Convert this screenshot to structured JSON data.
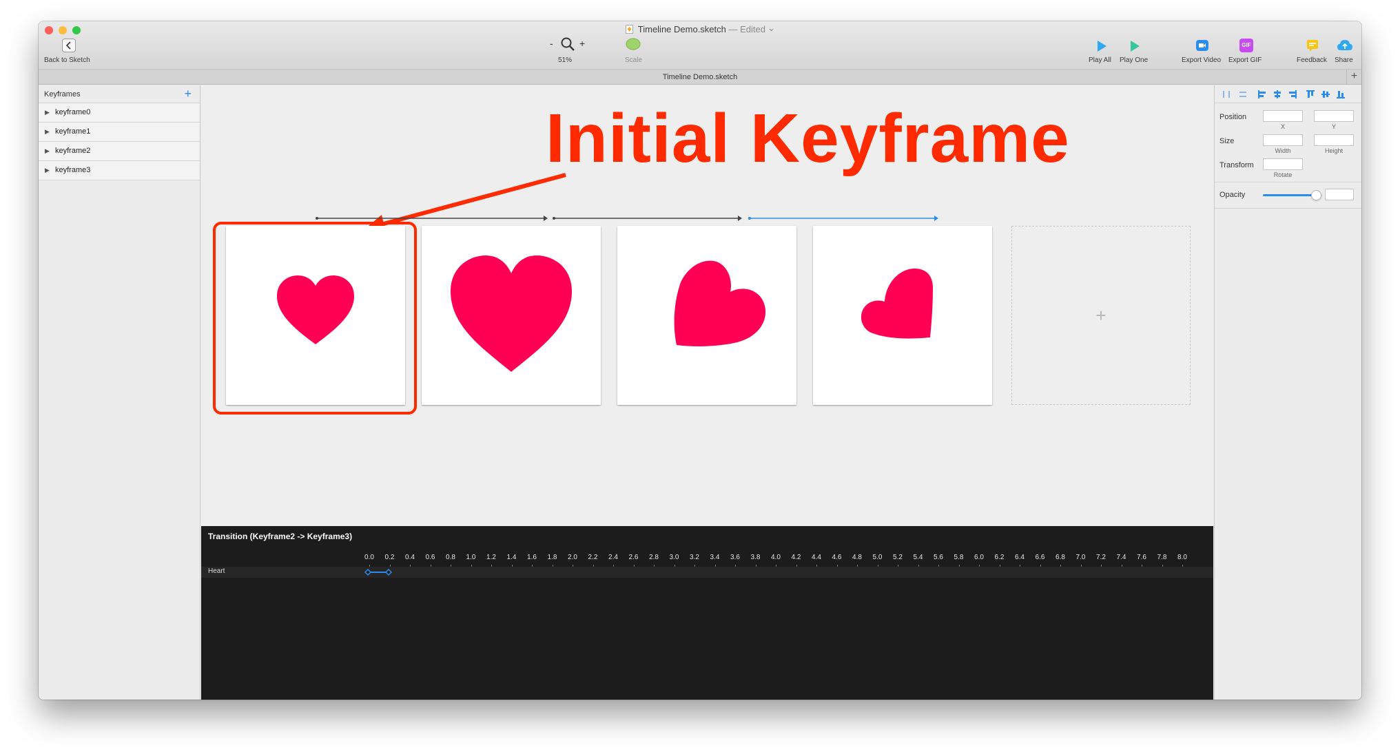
{
  "window": {
    "title": "Timeline Demo.sketch",
    "edited_label": "— Edited",
    "traffic_colors": [
      "#fc605b",
      "#fdbc40",
      "#34c84a"
    ]
  },
  "toolbar": {
    "back_label": "Back to Sketch",
    "zoom_minus": "-",
    "zoom_plus": "+",
    "zoom_value": "51%",
    "scale_label": "Scale",
    "play_all_label": "Play All",
    "play_one_label": "Play One",
    "export_video_label": "Export Video",
    "export_gif_label": "Export GIF",
    "gif_badge": "GIF",
    "feedback_label": "Feedback",
    "share_label": "Share"
  },
  "tab": {
    "title": "Timeline Demo.sketch",
    "add_label": "+"
  },
  "sidebar": {
    "header": "Keyframes",
    "add_label": "+",
    "items": [
      {
        "label": "keyframe0"
      },
      {
        "label": "keyframe1"
      },
      {
        "label": "keyframe2"
      },
      {
        "label": "keyframe3"
      }
    ]
  },
  "canvas": {
    "callout": "Initial Keyframe",
    "add_keyframe": "+",
    "accent_color": "#ff0055",
    "annotation_color": "#ff2a00"
  },
  "timeline": {
    "title": "Transition (Keyframe2 -> Keyframe3)",
    "track_label": "Heart",
    "ticks": [
      "0.0",
      "0.2",
      "0.4",
      "0.6",
      "0.8",
      "1.0",
      "1.2",
      "1.4",
      "1.6",
      "1.8",
      "2.0",
      "2.2",
      "2.4",
      "2.6",
      "2.8",
      "3.0",
      "3.2",
      "3.4",
      "3.6",
      "3.8",
      "4.0",
      "4.2",
      "4.4",
      "4.6",
      "4.8",
      "5.0",
      "5.2",
      "5.4",
      "5.6",
      "5.8",
      "6.0",
      "6.2",
      "6.4",
      "6.6",
      "6.8",
      "7.0",
      "7.2",
      "7.4",
      "7.6",
      "7.8",
      "8.0"
    ]
  },
  "inspector": {
    "position_label": "Position",
    "x_label": "X",
    "y_label": "Y",
    "size_label": "Size",
    "width_label": "Width",
    "height_label": "Height",
    "transform_label": "Transform",
    "rotate_label": "Rotate",
    "opacity_label": "Opacity",
    "opacity_level": 0.9
  }
}
